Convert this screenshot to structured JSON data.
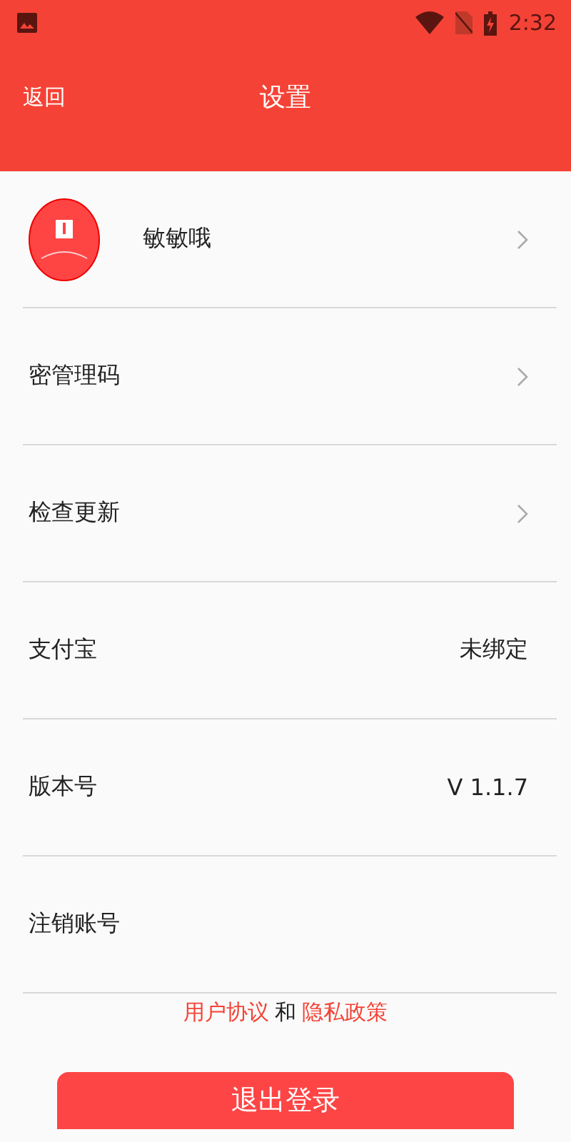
{
  "status_bar": {
    "time": "2:32"
  },
  "header": {
    "back": "返回",
    "title": "设置"
  },
  "rows": [
    {
      "kind": "profile",
      "label": "敏敏哦"
    },
    {
      "kind": "link",
      "label": "密管理码"
    },
    {
      "kind": "link",
      "label": "检查更新"
    },
    {
      "kind": "value",
      "label": "支付宝",
      "value": "未绑定"
    },
    {
      "kind": "value",
      "label": "版本号",
      "value": "V 1.1.7"
    },
    {
      "kind": "plain",
      "label": "注销账号"
    }
  ],
  "legal": {
    "user_agreement": "用户协议",
    "joiner": "和",
    "privacy_policy": "隐私政策"
  },
  "logout_button": "退出登录"
}
